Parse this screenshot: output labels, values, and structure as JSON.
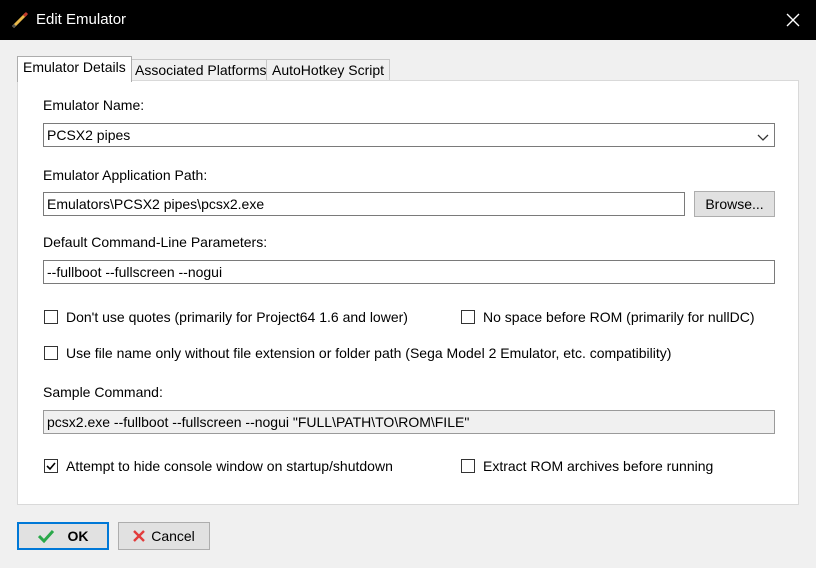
{
  "window": {
    "title": "Edit Emulator"
  },
  "tabs": [
    {
      "label": "Emulator Details",
      "active": true
    },
    {
      "label": "Associated Platforms",
      "active": false
    },
    {
      "label": "AutoHotkey Script",
      "active": false
    }
  ],
  "form": {
    "emulator_name": {
      "label": "Emulator Name:",
      "value": "PCSX2 pipes"
    },
    "app_path": {
      "label": "Emulator Application Path:",
      "value": "Emulators\\PCSX2 pipes\\pcsx2.exe",
      "browse_label": "Browse..."
    },
    "cmd_params": {
      "label": "Default Command-Line Parameters:",
      "value": "--fullboot --fullscreen --nogui"
    },
    "options": [
      {
        "label": "Don't use quotes (primarily for Project64 1.6 and lower)",
        "checked": false
      },
      {
        "label": "No space before ROM (primarily for nullDC)",
        "checked": false
      },
      {
        "label": "Use file name only without file extension or folder path (Sega Model 2 Emulator, etc. compatibility)",
        "checked": false
      }
    ],
    "sample": {
      "label": "Sample Command:",
      "value": "pcsx2.exe --fullboot --fullscreen --nogui \"FULL\\PATH\\TO\\ROM\\FILE\""
    },
    "bottom_options": [
      {
        "label": "Attempt to hide console window on startup/shutdown",
        "checked": true
      },
      {
        "label": "Extract ROM archives before running",
        "checked": false
      }
    ]
  },
  "footer": {
    "ok_label": "OK",
    "cancel_label": "Cancel"
  },
  "colors": {
    "accent": "#0078d7",
    "ok_green": "#2aa84a",
    "cancel_red": "#e23b3b",
    "titlebar": "#000000"
  },
  "icons": {
    "app": "pencil-icon",
    "close": "close-icon",
    "dropdown": "chevron-down-icon",
    "ok": "checkmark-icon",
    "cancel": "x-icon"
  }
}
